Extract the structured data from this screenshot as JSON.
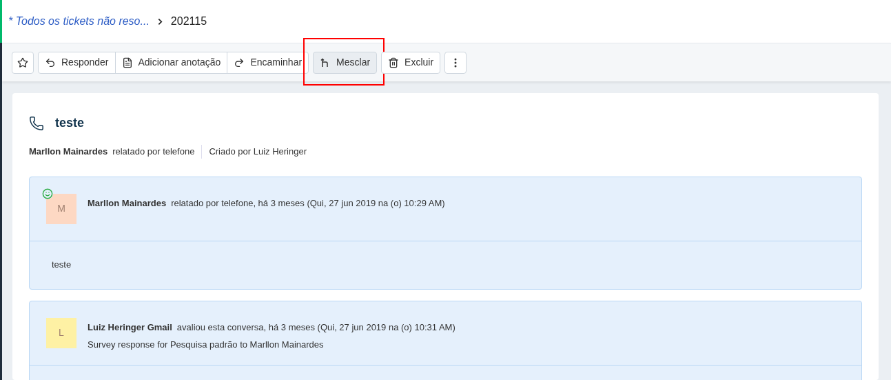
{
  "breadcrumb": {
    "parent": "* Todos os tickets não reso...",
    "current": "202115"
  },
  "toolbar": [
    {
      "kind": "icon",
      "highlighted": false
    },
    {
      "kind": "group",
      "items": [
        {
          "label": "Responder"
        },
        {
          "label": "Adicionar anotação"
        },
        {
          "label": "Encaminhar"
        }
      ]
    },
    {
      "kind": "button",
      "label": "Mesclar",
      "highlighted": true
    },
    {
      "kind": "button",
      "label": "Excluir",
      "highlighted": false
    },
    {
      "kind": "icon",
      "highlighted": false
    }
  ],
  "ticket": {
    "subject": "teste",
    "requester": "Marllon Mainardes",
    "source": "relatado por telefone",
    "created_by": "Criado por Luiz Heringer"
  },
  "conversations": [
    {
      "avatar": "M",
      "color": "#fdd8c3",
      "online": true,
      "author": "Marllon Mainardes",
      "meta": "relatado por telefone, há 3 meses (Qui, 27 jun 2019 na (o) 10:29 AM)",
      "body": "teste"
    },
    {
      "avatar": "L",
      "color": "#fef1a4",
      "online": false,
      "author": "Luiz Heringer Gmail",
      "meta": "avaliou esta conversa, há 3 meses (Qui, 27 jun 2019 na (o) 10:31 AM)",
      "summary": "Survey response for Pesquisa padrão to Marllon Mainardes"
    }
  ]
}
